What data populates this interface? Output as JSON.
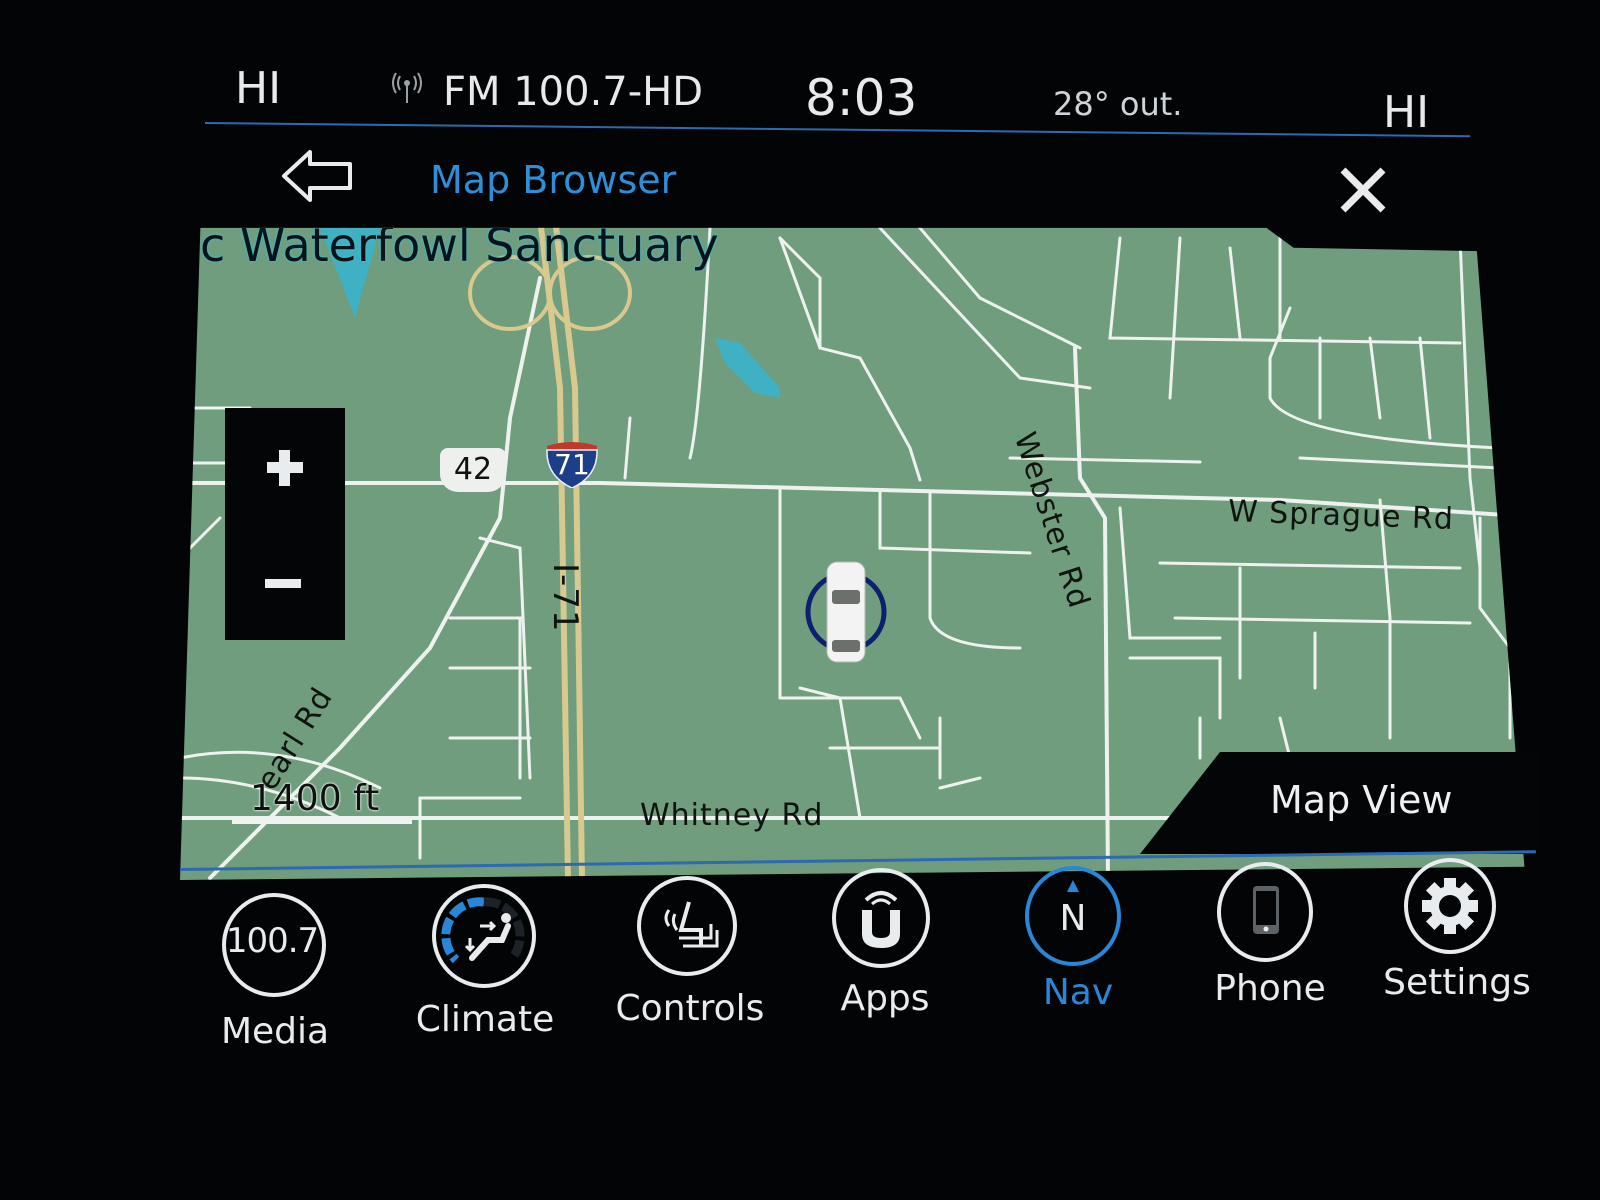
{
  "status_bar": {
    "left_climate": "HI",
    "radio_icon": "radio-signal-icon",
    "radio_station": "FM 100.7-HD",
    "time": "8:03",
    "outside_temp": "28° out.",
    "right_climate": "HI"
  },
  "title_bar": {
    "back_icon": "back-arrow-icon",
    "title": "Map Browser",
    "close_icon": "close-icon"
  },
  "map": {
    "poi_label": "c Waterfowl Sanctuary",
    "roads": {
      "whitney": "Whitney Rd",
      "webster": "Webster Rd",
      "sprague": "W Sprague Rd",
      "pearl": "earl Rd",
      "interstate": "I-71"
    },
    "shields": {
      "us_route": "42",
      "interstate": "71"
    },
    "scale": "1400 ft",
    "zoom_in_icon": "plus-icon",
    "zoom_out_icon": "minus-icon",
    "vehicle_icon": "car-position-icon",
    "map_view_label": "Map View"
  },
  "dock": {
    "items": [
      {
        "label": "Media",
        "icon": "media-icon",
        "icon_text": "100.7",
        "active": false
      },
      {
        "label": "Climate",
        "icon": "climate-icon",
        "active": false
      },
      {
        "label": "Controls",
        "icon": "seat-controls-icon",
        "active": false
      },
      {
        "label": "Apps",
        "icon": "uconnect-apps-icon",
        "active": false
      },
      {
        "label": "Nav",
        "icon": "compass-icon",
        "icon_text": "N",
        "active": true
      },
      {
        "label": "Phone",
        "icon": "phone-icon",
        "active": false
      },
      {
        "label": "Settings",
        "icon": "gear-icon",
        "active": false
      }
    ]
  },
  "colors": {
    "accent_blue": "#2a86d6",
    "map_green": "#6f9d7d",
    "interstate_tan": "#d8c98e",
    "water_cyan": "#3fb1c3"
  }
}
